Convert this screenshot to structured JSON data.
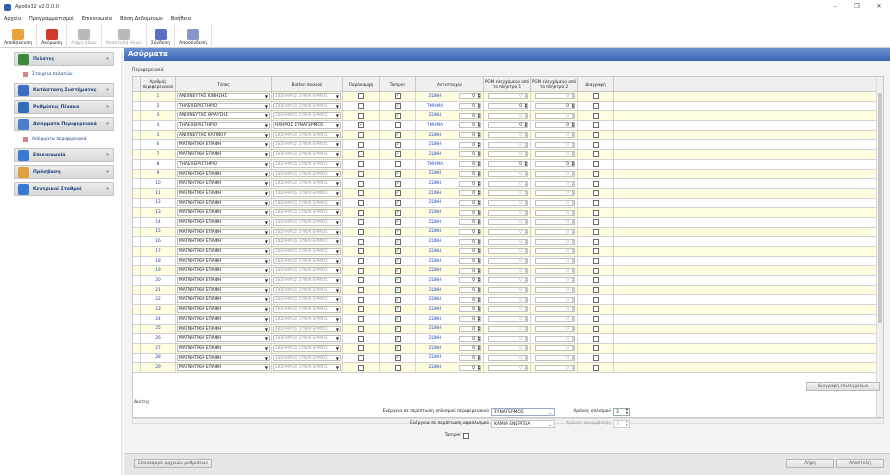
{
  "app": {
    "title": "Apollo32 v2.0.0.0"
  },
  "window_controls": [
    "–",
    "❐",
    "✕"
  ],
  "menu": [
    "Αρχείο",
    "Προγραμματισμοί",
    "Επικοινωνία",
    "Βάση Δεδομένων",
    "Βοήθεια"
  ],
  "toolbar": [
    {
      "label": "Αποθήκευση",
      "icon": "save-icon",
      "color": "#e8a33d",
      "enabled": true
    },
    {
      "label": "Ακύρωση",
      "icon": "cancel-x-icon",
      "color": "#d03a2a",
      "enabled": true
    },
    {
      "label": "Λήψη όλων",
      "icon": "download-all-icon",
      "color": "#b9b9b9",
      "enabled": false
    },
    {
      "label": "Αποστολή όλων",
      "icon": "upload-all-icon",
      "color": "#b9b9b9",
      "enabled": false
    },
    {
      "label": "Σύνδεση",
      "icon": "connect-plug-icon",
      "color": "#5a6fc4",
      "enabled": true
    },
    {
      "label": "Αποσύνδεση",
      "icon": "disconnect-plug-icon",
      "color": "#8a95c8",
      "enabled": true
    }
  ],
  "sidebar": {
    "groups": [
      {
        "label": "Πελάτες",
        "icon": "customers-icon",
        "color": "#3a8a3a",
        "chevron": "«",
        "items": [
          {
            "label": "Στοιχεία πελατών",
            "icon": "customer-card-icon"
          }
        ]
      },
      {
        "label": "Κατάσταση Συστήματος",
        "icon": "system-status-icon",
        "color": "#3b6fc6",
        "chevron": "»",
        "items": []
      },
      {
        "label": "Ρυθμίσεις Πίνακα",
        "icon": "panel-settings-icon",
        "color": "#2e6fb8",
        "chevron": "»",
        "items": []
      },
      {
        "label": "Ασύρματα Περιφερειακά",
        "icon": "wireless-icon",
        "color": "#4a7fd0",
        "chevron": "«",
        "items": [
          {
            "label": "Ασύρματα περιφερειακά",
            "icon": "wireless-item-icon"
          }
        ]
      },
      {
        "label": "Επικοινωνία",
        "icon": "communication-icon",
        "color": "#3a7ad0",
        "chevron": "»",
        "items": []
      },
      {
        "label": "Πρόσβαση",
        "icon": "access-icon",
        "color": "#e0a040",
        "chevron": "»",
        "items": []
      },
      {
        "label": "Κεντρικοί Σταθμοί",
        "icon": "central-stations-icon",
        "color": "#3a7ad0",
        "chevron": "»",
        "items": []
      }
    ]
  },
  "main": {
    "title": "Ασύρματα",
    "section_label": "Περιφερειακά",
    "columns": [
      "Αριθμός περιφερειακού",
      "Τύπος",
      "Button ποικιού",
      "Παράκαμψη",
      "Tamper",
      "Αντιστοιχία",
      "PGM ελεγχόμενο από το πλήκτρο 1",
      "PGM ελεγχόμενο από το πλήκτρο 2",
      "Διαγραφή"
    ],
    "rows": [
      {
        "n": "1",
        "type": "ΑΝΙΧΝΕΥΤΗΣ ΚΙΝΗΣΗΣ",
        "button": "ΣΙΩΠΗΡΟΣ ΣΥΝΑΓΕΡΜΟΣ",
        "btn_active": false,
        "bypass": false,
        "tamper": true,
        "assign": "ΖΩΝΗ",
        "assign_num": "0",
        "pgm1": "0",
        "pgm2": "0",
        "pgm_active": false,
        "delete": false
      },
      {
        "n": "2",
        "type": "ΤΗΛΕΧΕΙΡΙΣΤΗΡΙΟ",
        "button": "ΣΙΩΠΗΡΟΣ ΣΥΝΑΓΕΡΜΟΣ",
        "btn_active": false,
        "bypass": false,
        "tamper": true,
        "assign": "ΤΜΗΜΑ",
        "assign_num": "0",
        "pgm1": "0",
        "pgm2": "0",
        "pgm_active": true,
        "delete": false
      },
      {
        "n": "3",
        "type": "ΑΝΙΧΝΕΥΤΗΣ ΘΡΑΥΣΗΣ",
        "button": "ΣΙΩΠΗΡΟΣ ΣΥΝΑΓΕΡΜΟΣ",
        "btn_active": false,
        "bypass": false,
        "tamper": true,
        "assign": "ΖΩΝΗ",
        "assign_num": "0",
        "pgm1": "0",
        "pgm2": "0",
        "pgm_active": false,
        "delete": false
      },
      {
        "n": "4",
        "type": "ΤΗΛΕΧΕΙΡΙΣΤΗΡΙΟ",
        "button": "ΗΧΗΡΟΣ ΣΥΝΑΓΕΡΜΟΣ",
        "btn_active": true,
        "bypass": true,
        "tamper": false,
        "assign": "ΤΜΗΜΑ",
        "assign_num": "0",
        "pgm1": "0",
        "pgm2": "0",
        "pgm_active": true,
        "delete": false
      },
      {
        "n": "5",
        "type": "ΑΝΙΧΝΕΥΤΗΣ ΚΑΠΝΟΥ",
        "button": "ΣΙΩΠΗΡΟΣ ΣΥΝΑΓΕΡΜΟΣ",
        "btn_active": false,
        "bypass": false,
        "tamper": true,
        "assign": "ΖΩΝΗ",
        "assign_num": "0",
        "pgm1": "0",
        "pgm2": "0",
        "pgm_active": false,
        "delete": false
      },
      {
        "n": "6",
        "type": "ΜΑΓΝΗΤΙΚΗ ΕΠΑΦΗ",
        "button": "ΣΙΩΠΗΡΟΣ ΣΥΝΑΓΕΡΜΟΣ",
        "btn_active": false,
        "bypass": false,
        "tamper": true,
        "assign": "ΖΩΝΗ",
        "assign_num": "0",
        "pgm1": "0",
        "pgm2": "0",
        "pgm_active": false,
        "delete": false
      },
      {
        "n": "7",
        "type": "ΜΑΓΝΗΤΙΚΗ ΕΠΑΦΗ",
        "button": "ΣΙΩΠΗΡΟΣ ΣΥΝΑΓΕΡΜΟΣ",
        "btn_active": false,
        "bypass": false,
        "tamper": true,
        "assign": "ΖΩΝΗ",
        "assign_num": "0",
        "pgm1": "0",
        "pgm2": "0",
        "pgm_active": false,
        "delete": false
      },
      {
        "n": "8",
        "type": "ΤΗΛΕΧΕΙΡΙΣΤΗΡΙΟ",
        "button": "ΣΙΩΠΗΡΟΣ ΣΥΝΑΓΕΡΜΟΣ",
        "btn_active": false,
        "bypass": false,
        "tamper": false,
        "assign": "ΤΜΗΜΑ",
        "assign_num": "0",
        "pgm1": "0",
        "pgm2": "0",
        "pgm_active": true,
        "delete": false
      },
      {
        "n": "9",
        "type": "ΜΑΓΝΗΤΙΚΗ ΕΠΑΦΗ",
        "button": "ΣΙΩΠΗΡΟΣ ΣΥΝΑΓΕΡΜΟΣ",
        "btn_active": false,
        "bypass": false,
        "tamper": true,
        "assign": "ΖΩΝΗ",
        "assign_num": "0",
        "pgm1": "0",
        "pgm2": "0",
        "pgm_active": false,
        "delete": false
      },
      {
        "n": "10",
        "type": "ΜΑΓΝΗΤΙΚΗ ΕΠΑΦΗ",
        "button": "ΣΙΩΠΗΡΟΣ ΣΥΝΑΓΕΡΜΟΣ",
        "btn_active": false,
        "bypass": false,
        "tamper": true,
        "assign": "ΖΩΝΗ",
        "assign_num": "0",
        "pgm1": "0",
        "pgm2": "0",
        "pgm_active": false,
        "delete": false
      },
      {
        "n": "11",
        "type": "ΜΑΓΝΗΤΙΚΗ ΕΠΑΦΗ",
        "button": "ΣΙΩΠΗΡΟΣ ΣΥΝΑΓΕΡΜΟΣ",
        "btn_active": false,
        "bypass": false,
        "tamper": true,
        "assign": "ΖΩΝΗ",
        "assign_num": "0",
        "pgm1": "0",
        "pgm2": "0",
        "pgm_active": false,
        "delete": false
      },
      {
        "n": "12",
        "type": "ΜΑΓΝΗΤΙΚΗ ΕΠΑΦΗ",
        "button": "ΣΙΩΠΗΡΟΣ ΣΥΝΑΓΕΡΜΟΣ",
        "btn_active": false,
        "bypass": false,
        "tamper": true,
        "assign": "ΖΩΝΗ",
        "assign_num": "0",
        "pgm1": "0",
        "pgm2": "0",
        "pgm_active": false,
        "delete": false
      },
      {
        "n": "13",
        "type": "ΜΑΓΝΗΤΙΚΗ ΕΠΑΦΗ",
        "button": "ΣΙΩΠΗΡΟΣ ΣΥΝΑΓΕΡΜΟΣ",
        "btn_active": false,
        "bypass": false,
        "tamper": true,
        "assign": "ΖΩΝΗ",
        "assign_num": "0",
        "pgm1": "0",
        "pgm2": "0",
        "pgm_active": false,
        "delete": false
      },
      {
        "n": "14",
        "type": "ΜΑΓΝΗΤΙΚΗ ΕΠΑΦΗ",
        "button": "ΣΙΩΠΗΡΟΣ ΣΥΝΑΓΕΡΜΟΣ",
        "btn_active": false,
        "bypass": false,
        "tamper": true,
        "assign": "ΖΩΝΗ",
        "assign_num": "0",
        "pgm1": "0",
        "pgm2": "0",
        "pgm_active": false,
        "delete": false
      },
      {
        "n": "15",
        "type": "ΜΑΓΝΗΤΙΚΗ ΕΠΑΦΗ",
        "button": "ΣΙΩΠΗΡΟΣ ΣΥΝΑΓΕΡΜΟΣ",
        "btn_active": false,
        "bypass": false,
        "tamper": true,
        "assign": "ΖΩΝΗ",
        "assign_num": "0",
        "pgm1": "0",
        "pgm2": "0",
        "pgm_active": false,
        "delete": false
      },
      {
        "n": "16",
        "type": "ΜΑΓΝΗΤΙΚΗ ΕΠΑΦΗ",
        "button": "ΣΙΩΠΗΡΟΣ ΣΥΝΑΓΕΡΜΟΣ",
        "btn_active": false,
        "bypass": false,
        "tamper": true,
        "assign": "ΖΩΝΗ",
        "assign_num": "0",
        "pgm1": "0",
        "pgm2": "0",
        "pgm_active": false,
        "delete": false
      },
      {
        "n": "17",
        "type": "ΜΑΓΝΗΤΙΚΗ ΕΠΑΦΗ",
        "button": "ΣΙΩΠΗΡΟΣ ΣΥΝΑΓΕΡΜΟΣ",
        "btn_active": false,
        "bypass": false,
        "tamper": true,
        "assign": "ΖΩΝΗ",
        "assign_num": "0",
        "pgm1": "0",
        "pgm2": "0",
        "pgm_active": false,
        "delete": false
      },
      {
        "n": "18",
        "type": "ΜΑΓΝΗΤΙΚΗ ΕΠΑΦΗ",
        "button": "ΣΙΩΠΗΡΟΣ ΣΥΝΑΓΕΡΜΟΣ",
        "btn_active": false,
        "bypass": false,
        "tamper": true,
        "assign": "ΖΩΝΗ",
        "assign_num": "0",
        "pgm1": "0",
        "pgm2": "0",
        "pgm_active": false,
        "delete": false
      },
      {
        "n": "19",
        "type": "ΜΑΓΝΗΤΙΚΗ ΕΠΑΦΗ",
        "button": "ΣΙΩΠΗΡΟΣ ΣΥΝΑΓΕΡΜΟΣ",
        "btn_active": false,
        "bypass": false,
        "tamper": true,
        "assign": "ΖΩΝΗ",
        "assign_num": "0",
        "pgm1": "0",
        "pgm2": "0",
        "pgm_active": false,
        "delete": false
      },
      {
        "n": "20",
        "type": "ΜΑΓΝΗΤΙΚΗ ΕΠΑΦΗ",
        "button": "ΣΙΩΠΗΡΟΣ ΣΥΝΑΓΕΡΜΟΣ",
        "btn_active": false,
        "bypass": false,
        "tamper": true,
        "assign": "ΖΩΝΗ",
        "assign_num": "0",
        "pgm1": "0",
        "pgm2": "0",
        "pgm_active": false,
        "delete": false
      },
      {
        "n": "21",
        "type": "ΜΑΓΝΗΤΙΚΗ ΕΠΑΦΗ",
        "button": "ΣΙΩΠΗΡΟΣ ΣΥΝΑΓΕΡΜΟΣ",
        "btn_active": false,
        "bypass": false,
        "tamper": true,
        "assign": "ΖΩΝΗ",
        "assign_num": "0",
        "pgm1": "0",
        "pgm2": "0",
        "pgm_active": false,
        "delete": false
      },
      {
        "n": "22",
        "type": "ΜΑΓΝΗΤΙΚΗ ΕΠΑΦΗ",
        "button": "ΣΙΩΠΗΡΟΣ ΣΥΝΑΓΕΡΜΟΣ",
        "btn_active": false,
        "bypass": false,
        "tamper": true,
        "assign": "ΖΩΝΗ",
        "assign_num": "0",
        "pgm1": "0",
        "pgm2": "0",
        "pgm_active": false,
        "delete": false
      },
      {
        "n": "23",
        "type": "ΜΑΓΝΗΤΙΚΗ ΕΠΑΦΗ",
        "button": "ΣΙΩΠΗΡΟΣ ΣΥΝΑΓΕΡΜΟΣ",
        "btn_active": false,
        "bypass": false,
        "tamper": true,
        "assign": "ΖΩΝΗ",
        "assign_num": "0",
        "pgm1": "0",
        "pgm2": "0",
        "pgm_active": false,
        "delete": false
      },
      {
        "n": "24",
        "type": "ΜΑΓΝΗΤΙΚΗ ΕΠΑΦΗ",
        "button": "ΣΙΩΠΗΡΟΣ ΣΥΝΑΓΕΡΜΟΣ",
        "btn_active": false,
        "bypass": false,
        "tamper": true,
        "assign": "ΖΩΝΗ",
        "assign_num": "0",
        "pgm1": "0",
        "pgm2": "0",
        "pgm_active": false,
        "delete": false
      },
      {
        "n": "25",
        "type": "ΜΑΓΝΗΤΙΚΗ ΕΠΑΦΗ",
        "button": "ΣΙΩΠΗΡΟΣ ΣΥΝΑΓΕΡΜΟΣ",
        "btn_active": false,
        "bypass": false,
        "tamper": true,
        "assign": "ΖΩΝΗ",
        "assign_num": "0",
        "pgm1": "0",
        "pgm2": "0",
        "pgm_active": false,
        "delete": false
      },
      {
        "n": "26",
        "type": "ΜΑΓΝΗΤΙΚΗ ΕΠΑΦΗ",
        "button": "ΣΙΩΠΗΡΟΣ ΣΥΝΑΓΕΡΜΟΣ",
        "btn_active": false,
        "bypass": false,
        "tamper": true,
        "assign": "ΖΩΝΗ",
        "assign_num": "0",
        "pgm1": "0",
        "pgm2": "0",
        "pgm_active": false,
        "delete": false
      },
      {
        "n": "27",
        "type": "ΜΑΓΝΗΤΙΚΗ ΕΠΑΦΗ",
        "button": "ΣΙΩΠΗΡΟΣ ΣΥΝΑΓΕΡΜΟΣ",
        "btn_active": false,
        "bypass": false,
        "tamper": true,
        "assign": "ΖΩΝΗ",
        "assign_num": "0",
        "pgm1": "0",
        "pgm2": "0",
        "pgm_active": false,
        "delete": false
      },
      {
        "n": "28",
        "type": "ΜΑΓΝΗΤΙΚΗ ΕΠΑΦΗ",
        "button": "ΣΙΩΠΗΡΟΣ ΣΥΝΑΓΕΡΜΟΣ",
        "btn_active": false,
        "bypass": false,
        "tamper": true,
        "assign": "ΖΩΝΗ",
        "assign_num": "0",
        "pgm1": "0",
        "pgm2": "0",
        "pgm_active": false,
        "delete": false
      },
      {
        "n": "29",
        "type": "ΜΑΓΝΗΤΙΚΗ ΕΠΑΦΗ",
        "button": "ΣΙΩΠΗΡΟΣ ΣΥΝΑΓΕΡΜΟΣ",
        "btn_active": false,
        "bypass": false,
        "tamper": false,
        "assign": "ΖΩΝΗ",
        "assign_num": "0",
        "pgm1": "0",
        "pgm2": "0",
        "pgm_active": false,
        "delete": false
      }
    ],
    "delete_button": "Διαγραφή επιλεγμένων",
    "keypad_section_label": "Δίκτης",
    "event_armed_label": "Ενέργεια σε περίπτωση οπλισμού περιφερειακού",
    "event_armed_value": "ΣΥΝΑΓΕΡΜΟΣ",
    "event_disarmed_label": "Ενέργεια σε περίπτωση αφοπλισμού",
    "event_disarmed_value": "ΚΑΜΙΑ ΕΝΕΡΓΕΙΑ",
    "tamper_label": "Tamper",
    "arm_time_label": "Χρόνος οπλισμού",
    "arm_time_value": "3",
    "disarm_time_label": "Χρόνος παραμβολής",
    "disarm_time_value": "3",
    "restore_button": "Επαναφορά αρχικών ρυθμίσεων",
    "ok_button": "Λήψη",
    "send_button": "Αποστολή"
  }
}
